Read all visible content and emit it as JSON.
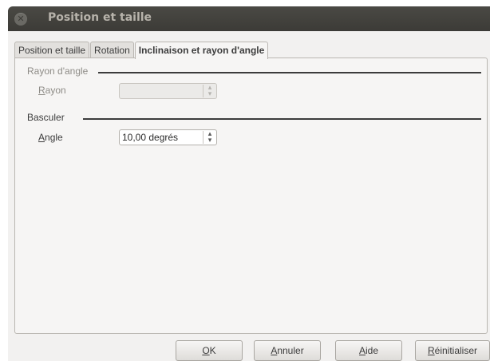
{
  "window": {
    "title": "Position et taille"
  },
  "tabs": [
    {
      "label": "Position et taille"
    },
    {
      "label": "Rotation"
    },
    {
      "label": "Inclinaison et rayon d'angle"
    }
  ],
  "corner_radius": {
    "title": "Rayon d'angle",
    "label_underline": "R",
    "label_rest": "ayon",
    "value": ""
  },
  "slant": {
    "title": "Basculer",
    "label_underline": "A",
    "label_rest": "ngle",
    "value": "10,00 degrés"
  },
  "buttons": {
    "ok_u": "O",
    "ok_rest": "K",
    "cancel_u": "A",
    "cancel_rest": "nnuler",
    "help_u": "A",
    "help_rest": "ide",
    "reset_u": "R",
    "reset_rest": "éinitialiser"
  }
}
